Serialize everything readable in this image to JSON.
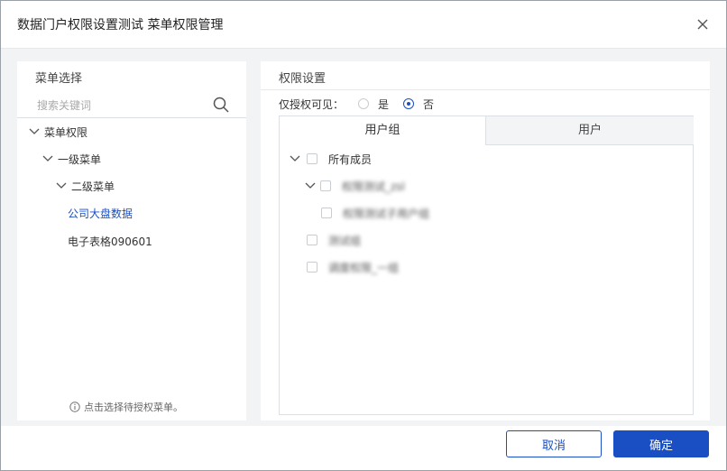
{
  "dialog": {
    "title": "数据门户权限设置测试 菜单权限管理",
    "close_icon": "close-icon"
  },
  "left_panel": {
    "title": "菜单选择",
    "search_placeholder": "搜索关键词",
    "tree": [
      {
        "label": "菜单权限",
        "expanded": true,
        "level": 0
      },
      {
        "label": "一级菜单",
        "expanded": true,
        "level": 1
      },
      {
        "label": "二级菜单",
        "expanded": true,
        "level": 2
      },
      {
        "label": "公司大盘数据",
        "selected": true,
        "level": 3
      },
      {
        "label": "电子表格090601",
        "level": 3
      }
    ],
    "hint": "点击选择待授权菜单。"
  },
  "right_panel": {
    "title": "权限设置",
    "visible_label": "仅授权可见：",
    "options": [
      {
        "label": "是",
        "selected": false
      },
      {
        "label": "否",
        "selected": true
      }
    ],
    "tabs": [
      {
        "label": "用户组",
        "active": true
      },
      {
        "label": "用户",
        "active": false
      }
    ],
    "members": [
      {
        "label": "所有成员",
        "level": 0,
        "expanded": true,
        "blurred": false
      },
      {
        "label": "权限测试_zsl",
        "level": 1,
        "expanded": true,
        "blurred": true
      },
      {
        "label": "权限测试子用户组",
        "level": 2,
        "blurred": true
      },
      {
        "label": "测试组",
        "level": 0,
        "blurred": true
      },
      {
        "label": "调度权限_一组",
        "level": 0,
        "blurred": true
      }
    ]
  },
  "footer": {
    "cancel_label": "取消",
    "ok_label": "确定"
  },
  "colors": {
    "accent": "#1a4fc4",
    "border": "#dcdfe4",
    "background": "#f2f3f5"
  }
}
